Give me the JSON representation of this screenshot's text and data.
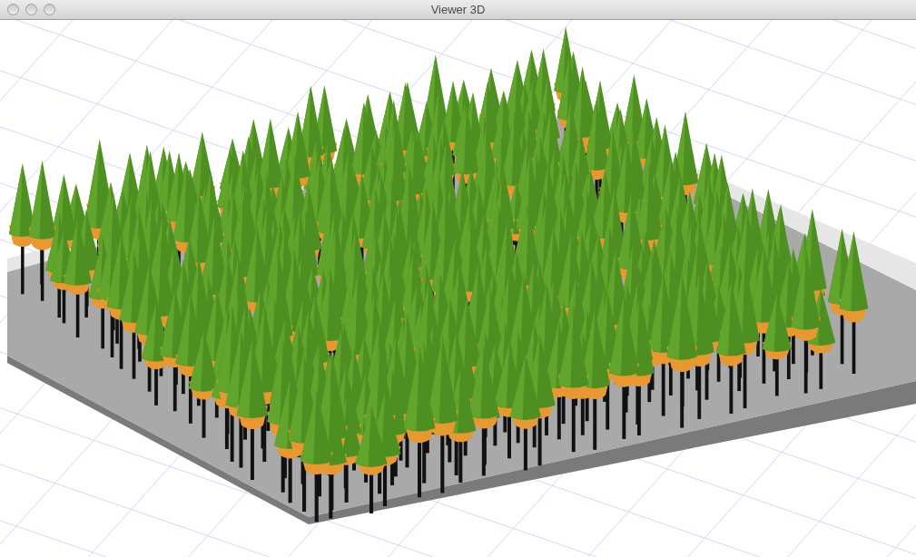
{
  "window": {
    "title": "Viewer 3D"
  }
}
